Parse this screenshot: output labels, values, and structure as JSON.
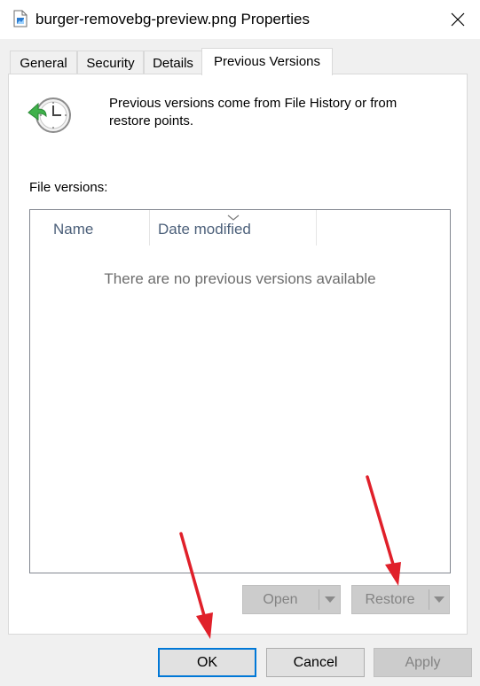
{
  "window": {
    "title": "burger-removebg-preview.png Properties",
    "close_icon": "close-icon"
  },
  "tabs": [
    {
      "label": "General",
      "active": false
    },
    {
      "label": "Security",
      "active": false
    },
    {
      "label": "Details",
      "active": false
    },
    {
      "label": "Previous Versions",
      "active": true
    }
  ],
  "info": {
    "text": "Previous versions come from File History or from restore points.",
    "icon": "file-history-icon"
  },
  "file_versions": {
    "label": "File versions:",
    "columns": [
      "Name",
      "Date modified"
    ],
    "empty_message": "There are no previous versions available"
  },
  "actions": {
    "open_label": "Open",
    "restore_label": "Restore"
  },
  "footer": {
    "ok_label": "OK",
    "cancel_label": "Cancel",
    "apply_label": "Apply"
  },
  "colors": {
    "accent": "#0078d7",
    "annotation_arrow": "#e0202a"
  }
}
